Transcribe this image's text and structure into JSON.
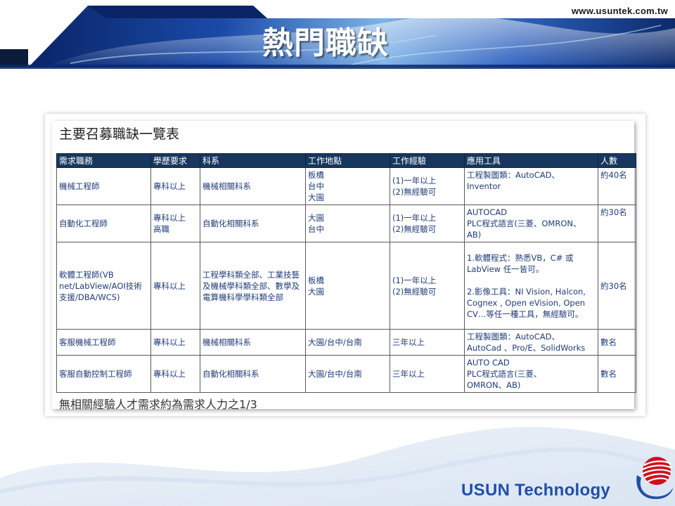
{
  "header": {
    "site_url": "www.usuntek.com.tw",
    "title": "熱門職缺"
  },
  "table": {
    "heading": "主要召募職缺一覽表",
    "columns": [
      "需求職務",
      "學歷要求",
      "科系",
      "工作地點",
      "工作經驗",
      "應用工具",
      "人數"
    ],
    "rows": [
      {
        "position": "機械工程師",
        "education": "專科以上",
        "major": "機械相關科系",
        "location": "板橋\n台中\n大園",
        "experience": "(1)一年以上\n(2)無經驗可",
        "tools": "工程製圖類：AutoCAD、\nInventor",
        "count": "約40名"
      },
      {
        "position": "自動化工程師",
        "education": "專科以上\n高職",
        "major": "自動化相關科系",
        "location": "大園\n台中",
        "experience": "(1)一年以上\n(2)無經驗可",
        "tools": "AUTOCAD\nPLC程式語言(三菱、OMRON、\nAB)",
        "count": "約30名"
      },
      {
        "position": "軟體工程師(VB\nnet/LabView/AOI技術\n支援/DBA/WCS)",
        "education": "專科以上",
        "major": "工程學科類全部、工業技藝\n及機械學科類全部、數學及\n電算機科學學科類全部",
        "location": "板橋\n大園",
        "experience": "(1)一年以上\n(2)無經驗可",
        "tools": "1.軟體程式：熟悉VB，C# 或\nLabView 任一皆可。\n\n2.影像工具：NI Vision, Halcon,\nCognex , Open eVision, Open\nCV…等任一種工具，無經驗可。",
        "count": "約30名"
      },
      {
        "position": "客服機械工程師",
        "education": "專科以上",
        "major": "機械相關科系",
        "location": "大園/台中/台南",
        "experience": "三年以上",
        "tools": "工程製圖類：AutoCAD、\nAutoCad 、Pro/E、SolidWorks",
        "count": "數名"
      },
      {
        "position": "客服自動控制工程師",
        "education": "專科以上",
        "major": "自動化相關科系",
        "location": "大園/台中/台南",
        "experience": "三年以上",
        "tools": "AUTO CAD\nPLC程式語言(三菱、\nOMRON、AB)",
        "count": "數名"
      }
    ],
    "footnote": "無相關經驗人才需求約為需求人力之1/3"
  },
  "footer": {
    "brand": "USUN Technology",
    "logo_icon": "usun-swoosh-logo-icon"
  },
  "colors": {
    "banner_dark": "#0b2a6b",
    "banner_light": "#6fa8dc",
    "table_header": "#17375e",
    "table_text": "#1f3c78",
    "brand_blue": "#1f4fa8",
    "logo_red": "#d0101a"
  }
}
